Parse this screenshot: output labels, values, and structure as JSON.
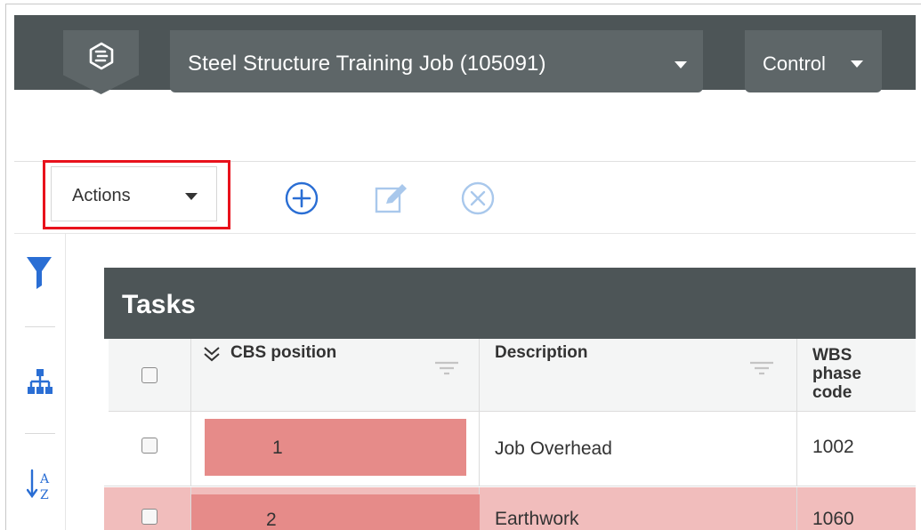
{
  "header": {
    "job_selector": "Steel Structure Training Job (105091)",
    "control_selector": "Control"
  },
  "toolbar": {
    "actions_label": "Actions",
    "icons": [
      "add-circle-icon",
      "edit-icon",
      "cancel-circle-icon"
    ]
  },
  "rail": {
    "icons": [
      "filter-icon",
      "hierarchy-icon",
      "sort-az-icon"
    ]
  },
  "grid": {
    "title": "Tasks",
    "columns": {
      "cbs_position": "CBS position",
      "description": "Description",
      "wbs_line1": "WBS",
      "wbs_line2": "phase",
      "wbs_line3": "code"
    },
    "rows": [
      {
        "cbs_position": "1",
        "description": "Job Overhead",
        "wbs_phase_code": "1002"
      },
      {
        "cbs_position": "2",
        "description": "Earthwork",
        "wbs_phase_code": "1060"
      }
    ]
  },
  "colors": {
    "header_bg": "#4d5557",
    "header_tile": "#5e6668",
    "highlight_border": "#e8121c",
    "row_highlight": "#e68b89",
    "row_light": "#f1bdbc",
    "accent_blue": "#2a6ed4"
  }
}
